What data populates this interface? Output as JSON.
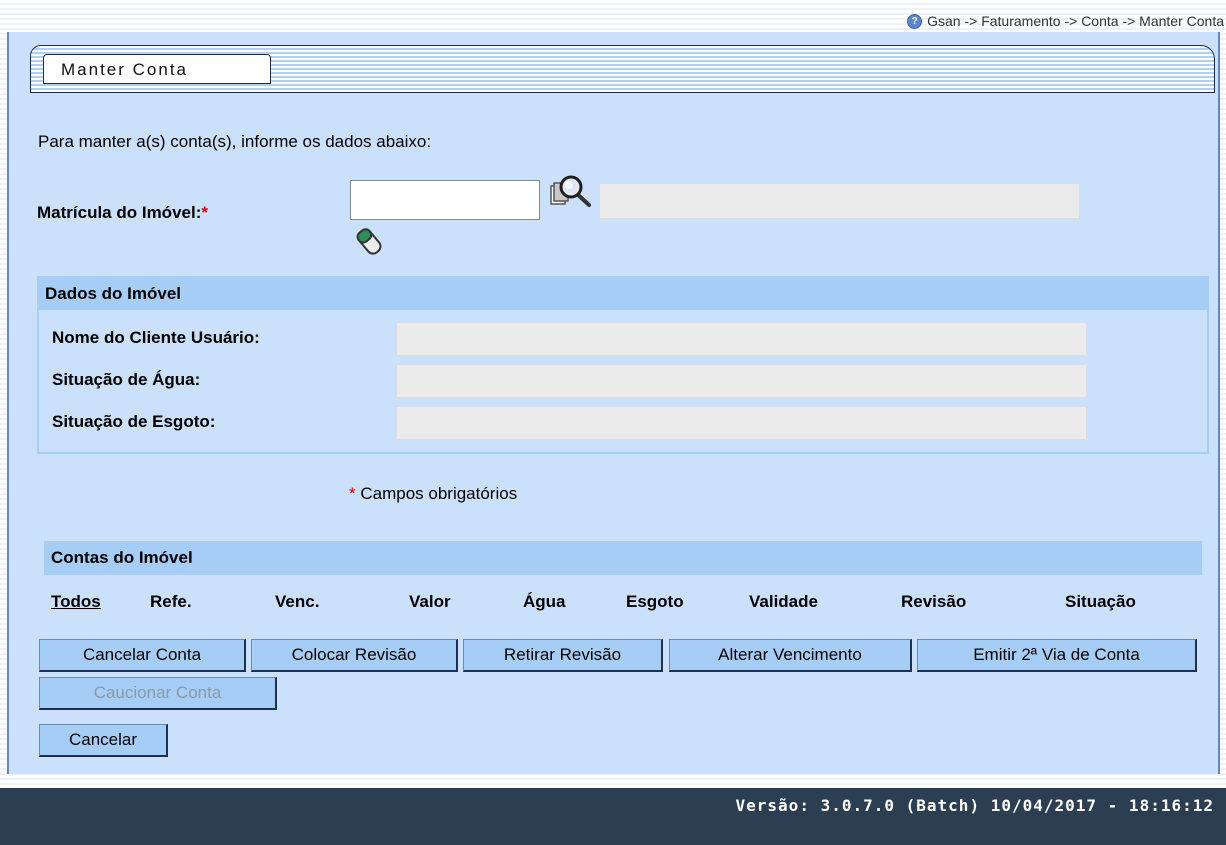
{
  "breadcrumb": "Gsan -> Faturamento -> Conta -> Manter Conta",
  "page_title": "Manter Conta",
  "intro_text": "Para manter a(s) conta(s), informe os dados abaixo:",
  "matricula": {
    "label": "Matrícula do Imóvel:",
    "required_mark": "*",
    "value": "",
    "description": ""
  },
  "dados_imovel": {
    "header": "Dados do Imóvel",
    "fields": [
      {
        "label": "Nome do Cliente Usuário:",
        "value": ""
      },
      {
        "label": "Situação de Água:",
        "value": ""
      },
      {
        "label": "Situação de Esgoto:",
        "value": ""
      }
    ]
  },
  "required_note": {
    "mark": "*",
    "text": " Campos obrigatórios"
  },
  "contas": {
    "header": "Contas do Imóvel",
    "columns": [
      "Todos",
      "Refe.",
      "Venc.",
      "Valor",
      "Água",
      "Esgoto",
      "Validade",
      "Revisão",
      "Situação"
    ]
  },
  "buttons": {
    "cancelar_conta": "Cancelar Conta",
    "colocar_revisao": "Colocar Revisão",
    "retirar_revisao": "Retirar Revisão",
    "alterar_vencimento": "Alterar Vencimento",
    "emitir_2via": "Emitir 2ª Via de Conta",
    "caucionar_conta": "Caucionar Conta",
    "cancelar": "Cancelar"
  },
  "footer": {
    "version": "Versão: 3.0.7.0 (Batch) 10/04/2017 - 18:16:12"
  },
  "colors": {
    "panel_bg": "#cbe0fb",
    "header_bg": "#a6cdf5",
    "footer_bg": "#2c3e52",
    "required": "#e00000"
  }
}
